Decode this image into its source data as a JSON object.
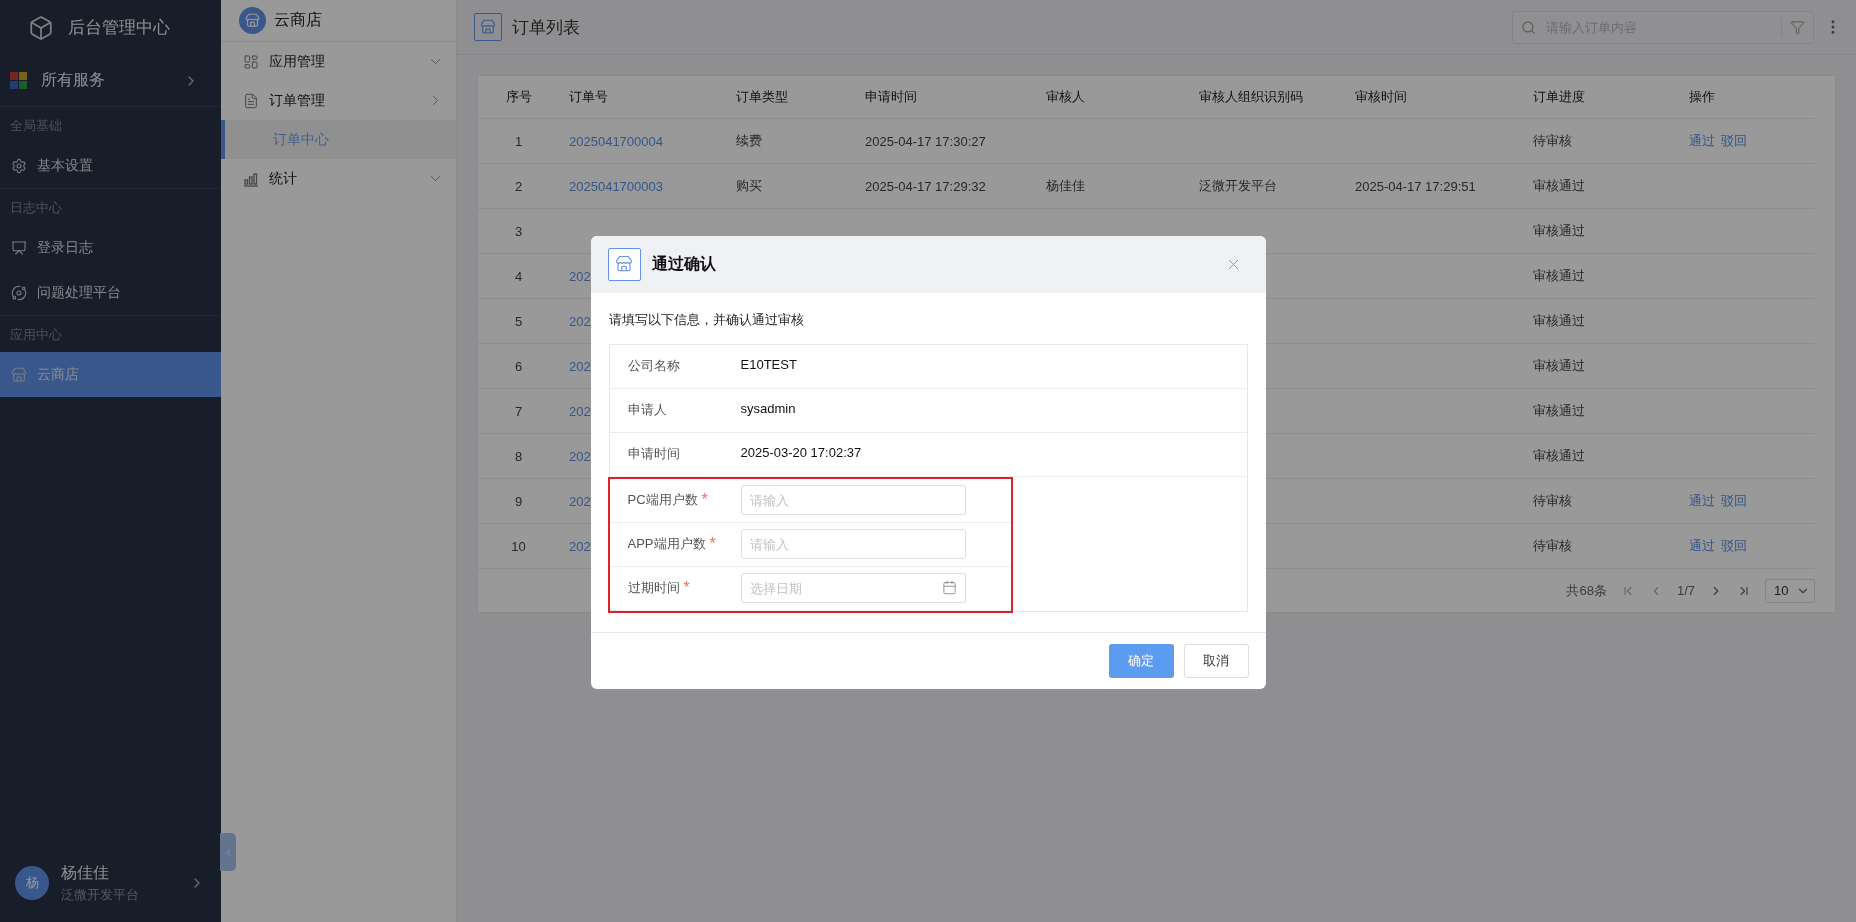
{
  "sidebar": {
    "title": "后台管理中心",
    "all_services": "所有服务",
    "sections": [
      {
        "label": "全局基础",
        "items": [
          {
            "kind": "settings",
            "label": "基本设置",
            "selected": false
          }
        ]
      },
      {
        "label": "日志中心",
        "items": [
          {
            "kind": "log",
            "label": "登录日志",
            "selected": false
          },
          {
            "kind": "planet",
            "label": "问题处理平台",
            "selected": false
          }
        ]
      },
      {
        "label": "应用中心",
        "items": [
          {
            "kind": "store",
            "label": "云商店",
            "selected": true
          }
        ]
      }
    ],
    "user": {
      "avatar": "杨",
      "name": "杨佳佳",
      "org": "泛微开发平台"
    }
  },
  "submenu": {
    "title": "云商店",
    "items": [
      {
        "kind": "app",
        "label": "应用管理",
        "expanded": false
      },
      {
        "kind": "order",
        "label": "订单管理",
        "expanded": true,
        "children": [
          {
            "label": "订单中心",
            "selected": true
          }
        ]
      },
      {
        "kind": "chart",
        "label": "统计",
        "expanded": false
      }
    ]
  },
  "page": {
    "title": "订单列表",
    "search": {
      "placeholder": "请输入订单内容"
    }
  },
  "table": {
    "columns": [
      "序号",
      "订单号",
      "订单类型",
      "申请时间",
      "审核人",
      "审核人组织识别码",
      "审核时间",
      "订单进度",
      "操作"
    ],
    "rows": [
      {
        "index": "1",
        "order_no": "2025041700004",
        "type": "续费",
        "apply_time": "2025-04-17 17:30:27",
        "progress": "待审核",
        "actions": [
          "通过",
          "驳回"
        ]
      },
      {
        "index": "2",
        "order_no": "2025041700003",
        "type": "购买",
        "apply_time": "2025-04-17 17:29:32",
        "reviewer": "杨佳佳",
        "reviewer_org": "泛微开发平台",
        "review_time": "2025-04-17 17:29:51",
        "progress": "审核通过",
        "actions": []
      },
      {
        "index": "3",
        "progress": "审核通过",
        "actions": []
      },
      {
        "index": "4",
        "order_no": "202",
        "progress": "审核通过",
        "actions": []
      },
      {
        "index": "5",
        "order_no": "202",
        "progress": "审核通过",
        "actions": []
      },
      {
        "index": "6",
        "order_no": "202",
        "progress": "审核通过",
        "actions": []
      },
      {
        "index": "7",
        "order_no": "202",
        "progress": "审核通过",
        "actions": []
      },
      {
        "index": "8",
        "order_no": "202",
        "progress": "审核通过",
        "actions": []
      },
      {
        "index": "9",
        "order_no": "202",
        "progress": "待审核",
        "actions": [
          "通过",
          "驳回"
        ]
      },
      {
        "index": "10",
        "order_no": "202",
        "progress": "待审核",
        "actions": [
          "通过",
          "驳回"
        ]
      }
    ]
  },
  "pagination": {
    "total": "共68条",
    "page": "1/7",
    "page_size": "10"
  },
  "dialog": {
    "title": "通过确认",
    "intro": "请填写以下信息，并确认通过审核",
    "fields": [
      {
        "kind": "text",
        "label": "公司名称",
        "value": "E10TEST",
        "required": false
      },
      {
        "kind": "text",
        "label": "申请人",
        "value": "sysadmin",
        "required": false
      },
      {
        "kind": "text",
        "label": "申请时间",
        "value": "2025-03-20 17:02:37",
        "required": false
      },
      {
        "kind": "input",
        "label": "PC端用户数",
        "placeholder": "请输入",
        "required": true
      },
      {
        "kind": "input",
        "label": "APP端用户数",
        "placeholder": "请输入",
        "required": true
      },
      {
        "kind": "date",
        "label": "过期时间",
        "placeholder": "选择日期",
        "required": true
      }
    ],
    "required_mark": "*",
    "confirm": "确定",
    "cancel": "取消"
  }
}
